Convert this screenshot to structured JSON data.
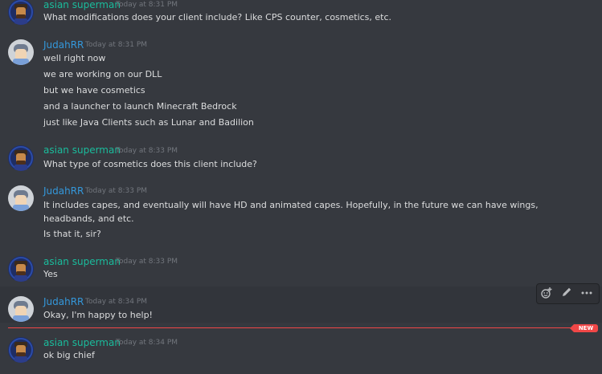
{
  "messages": [
    {
      "username": "asian superman",
      "timestamp": "Today at 8:31 PM",
      "lines": [
        "What modifications does your client include? Like CPS counter, cosmetics, etc."
      ]
    },
    {
      "username": "JudahRR",
      "timestamp": "Today at 8:31 PM",
      "lines": [
        "well right now",
        "we are working on our DLL",
        "but we have cosmetics",
        "and a launcher to launch Minecraft Bedrock",
        "just like Java Clients such as Lunar and Badilion"
      ]
    },
    {
      "username": "asian superman",
      "timestamp": "Today at 8:33 PM",
      "lines": [
        "What type of cosmetics does this client include?"
      ]
    },
    {
      "username": "JudahRR",
      "timestamp": "Today at 8:33 PM",
      "lines": [
        "It includes capes, and eventually will have HD and animated capes. Hopefully, in the future we can have wings, headbands, and etc.",
        "Is that it, sir?"
      ]
    },
    {
      "username": "asian superman",
      "timestamp": "Today at 8:33 PM",
      "lines": [
        "Yes"
      ]
    },
    {
      "username": "JudahRR",
      "timestamp": "Today at 8:34 PM",
      "lines": [
        "Okay, I'm happy to help!"
      ]
    },
    {
      "username": "asian superman",
      "timestamp": "Today at 8:34 PM",
      "lines": [
        "ok big chief"
      ]
    }
  ],
  "divider": {
    "label": "NEW"
  },
  "toolbar": {
    "icons": [
      "add-reaction-icon",
      "edit-icon",
      "more-icon"
    ]
  },
  "colors": {
    "asian_name": "#1abc9c",
    "judah_name": "#3498db",
    "new_divider": "#f04747",
    "background": "#36393f"
  }
}
